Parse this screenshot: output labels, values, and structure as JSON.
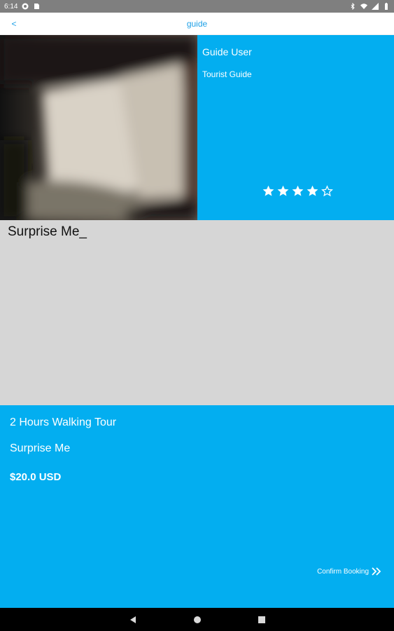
{
  "status_bar": {
    "time": "6:14"
  },
  "app_bar": {
    "back_label": "<",
    "title": "guide"
  },
  "guide": {
    "name": "Guide User",
    "role": "Tourist Guide",
    "rating": 4,
    "rating_max": 5
  },
  "tour": {
    "heading": "Surprise Me_"
  },
  "details": {
    "duration": "2 Hours Walking Tour",
    "name": "Surprise Me",
    "price": "$20.0 USD",
    "confirm_label": "Confirm Booking"
  },
  "colors": {
    "accent": "#03aef0",
    "link": "#1ea0e6",
    "surface": "#d6d6d6"
  },
  "icons": {
    "back": "back-chevron-icon",
    "star_filled": "star-filled-icon",
    "star_empty": "star-outline-icon",
    "confirm": "double-chevron-right-icon"
  }
}
